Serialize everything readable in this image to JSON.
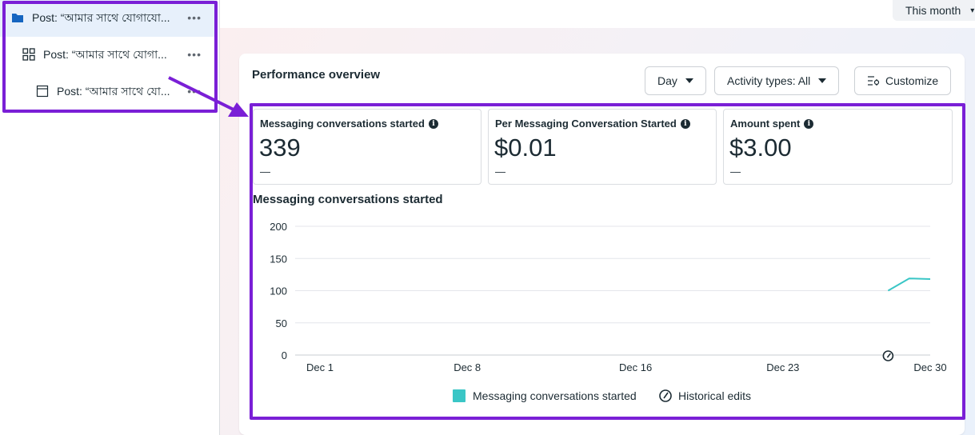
{
  "sidebar": {
    "items": [
      {
        "label": "Post: “আমার সাথে যোগাযো...",
        "icon": "folder-icon",
        "more": "•••"
      },
      {
        "label": "Post: “আমার সাথে যোগা...",
        "icon": "grid-icon",
        "more": "•••"
      },
      {
        "label": "Post: “আমার সাথে যো...",
        "icon": "ad-icon",
        "more": "•••"
      }
    ]
  },
  "header": {
    "date_range": "This month"
  },
  "performance": {
    "title": "Performance overview",
    "controls": {
      "granularity": "Day",
      "activity_types": "Activity types: All",
      "customize": "Customize"
    },
    "metrics": [
      {
        "label": "Messaging conversations started",
        "value": "339",
        "delta": "—"
      },
      {
        "label": "Per Messaging Conversation Started",
        "value": "$0.01",
        "delta": "—"
      },
      {
        "label": "Amount spent",
        "value": "$3.00",
        "delta": "—"
      }
    ],
    "chart_title": "Messaging conversations started"
  },
  "colors": {
    "highlight": "#7a1fd6",
    "series": "#3ac6c6",
    "active_row": "#e7f0fb",
    "folder": "#1565c0"
  },
  "chart_data": {
    "type": "line",
    "title": "Messaging conversations started",
    "x_ticks": [
      "Dec 1",
      "Dec 8",
      "Dec 16",
      "Dec 23",
      "Dec 30"
    ],
    "y_ticks": [
      0,
      50,
      100,
      150,
      200
    ],
    "ylim": [
      0,
      200
    ],
    "xlim": [
      1,
      30
    ],
    "grid": true,
    "series": [
      {
        "name": "Messaging conversations started",
        "x": [
          28,
          29,
          30
        ],
        "values": [
          100,
          119,
          118
        ]
      }
    ],
    "annotations": [
      {
        "type": "historical-edit",
        "x": 28
      }
    ],
    "legend": [
      "Messaging conversations started",
      "Historical edits"
    ],
    "legend_position": "bottom"
  }
}
